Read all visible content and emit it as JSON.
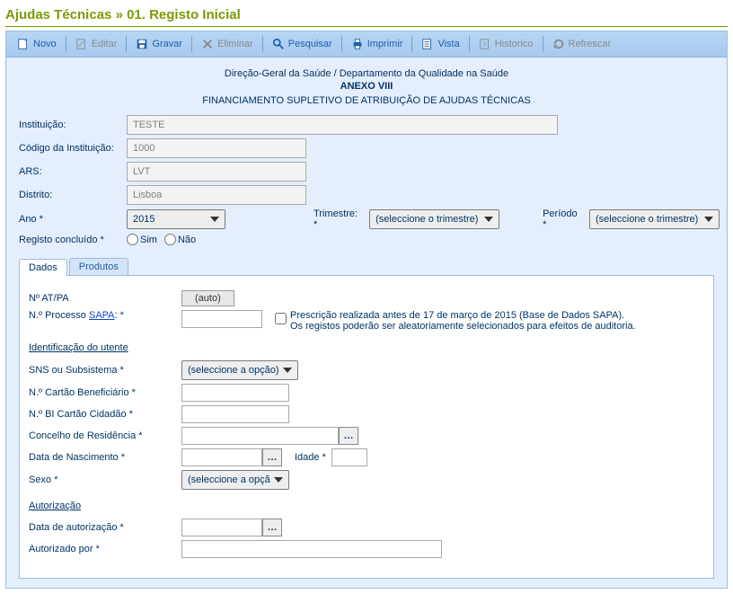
{
  "breadcrumb": {
    "module": "Ajudas Técnicas",
    "sep": "»",
    "page": "01. Registo Inicial"
  },
  "toolbar": {
    "novo": "Novo",
    "editar": "Editar",
    "gravar": "Gravar",
    "eliminar": "Eliminar",
    "pesquisar": "Pesquisar",
    "imprimir": "Imprimir",
    "vista": "Vista",
    "historico": "Historico",
    "refrescar": "Refrescar"
  },
  "header": {
    "org": "Direção-Geral da Saúde / Departamento da Qualidade na Saúde",
    "anexo": "ANEXO VIII",
    "titulo": "FINANCIAMENTO SUPLETIVO DE ATRIBUIÇÃO DE AJUDAS TÉCNICAS"
  },
  "form": {
    "instituicao_lbl": "Instituição:",
    "instituicao_val": "TESTE",
    "codigo_lbl": "Código da Instituição:",
    "codigo_val": "1000",
    "ars_lbl": "ARS:",
    "ars_val": "LVT",
    "distrito_lbl": "Distrito:",
    "distrito_val": "Lisboa",
    "ano_lbl": "Ano *",
    "ano_val": "2015",
    "trimestre_lbl": "Trimestre: *",
    "trimestre_val": "(seleccione o trimestre)",
    "periodo_lbl": "Período *",
    "periodo_val": "(seleccione o trimestre)",
    "registo_lbl": "Registo concluído *",
    "sim": "Sim",
    "nao": "Não"
  },
  "tabs": {
    "dados": "Dados",
    "produtos": "Produtos"
  },
  "dados": {
    "natpa_lbl": "Nº AT/PA",
    "natpa_val": "(auto)",
    "proc_lbl_pre": "N.º Processo ",
    "proc_link": "SAPA",
    "proc_lbl_suf": ": *",
    "presc_note_l1": "Prescrição realizada antes de 17 de março de 2015 (Base de Dados SAPA).",
    "presc_note_l2": "Os registos poderão ser aleatoriamente selecionados para efeitos de auditoria.",
    "ident_title": "Identificação do utente",
    "sns_lbl": "SNS ou Subsistema *",
    "sns_val": "(seleccione a opção)",
    "cartao_lbl": "N.º Cartão Beneficiário *",
    "bi_lbl": "N.º BI Cartão Cidadão *",
    "concelho_lbl": "Concelho de Residência *",
    "dn_lbl": "Data de Nascimento *",
    "idade_lbl": "Idade *",
    "sexo_lbl": "Sexo *",
    "sexo_val": "(seleccione a opção)",
    "aut_title": "Autorização",
    "dataaut_lbl": "Data de autorização *",
    "autpor_lbl": "Autorizado por *"
  }
}
